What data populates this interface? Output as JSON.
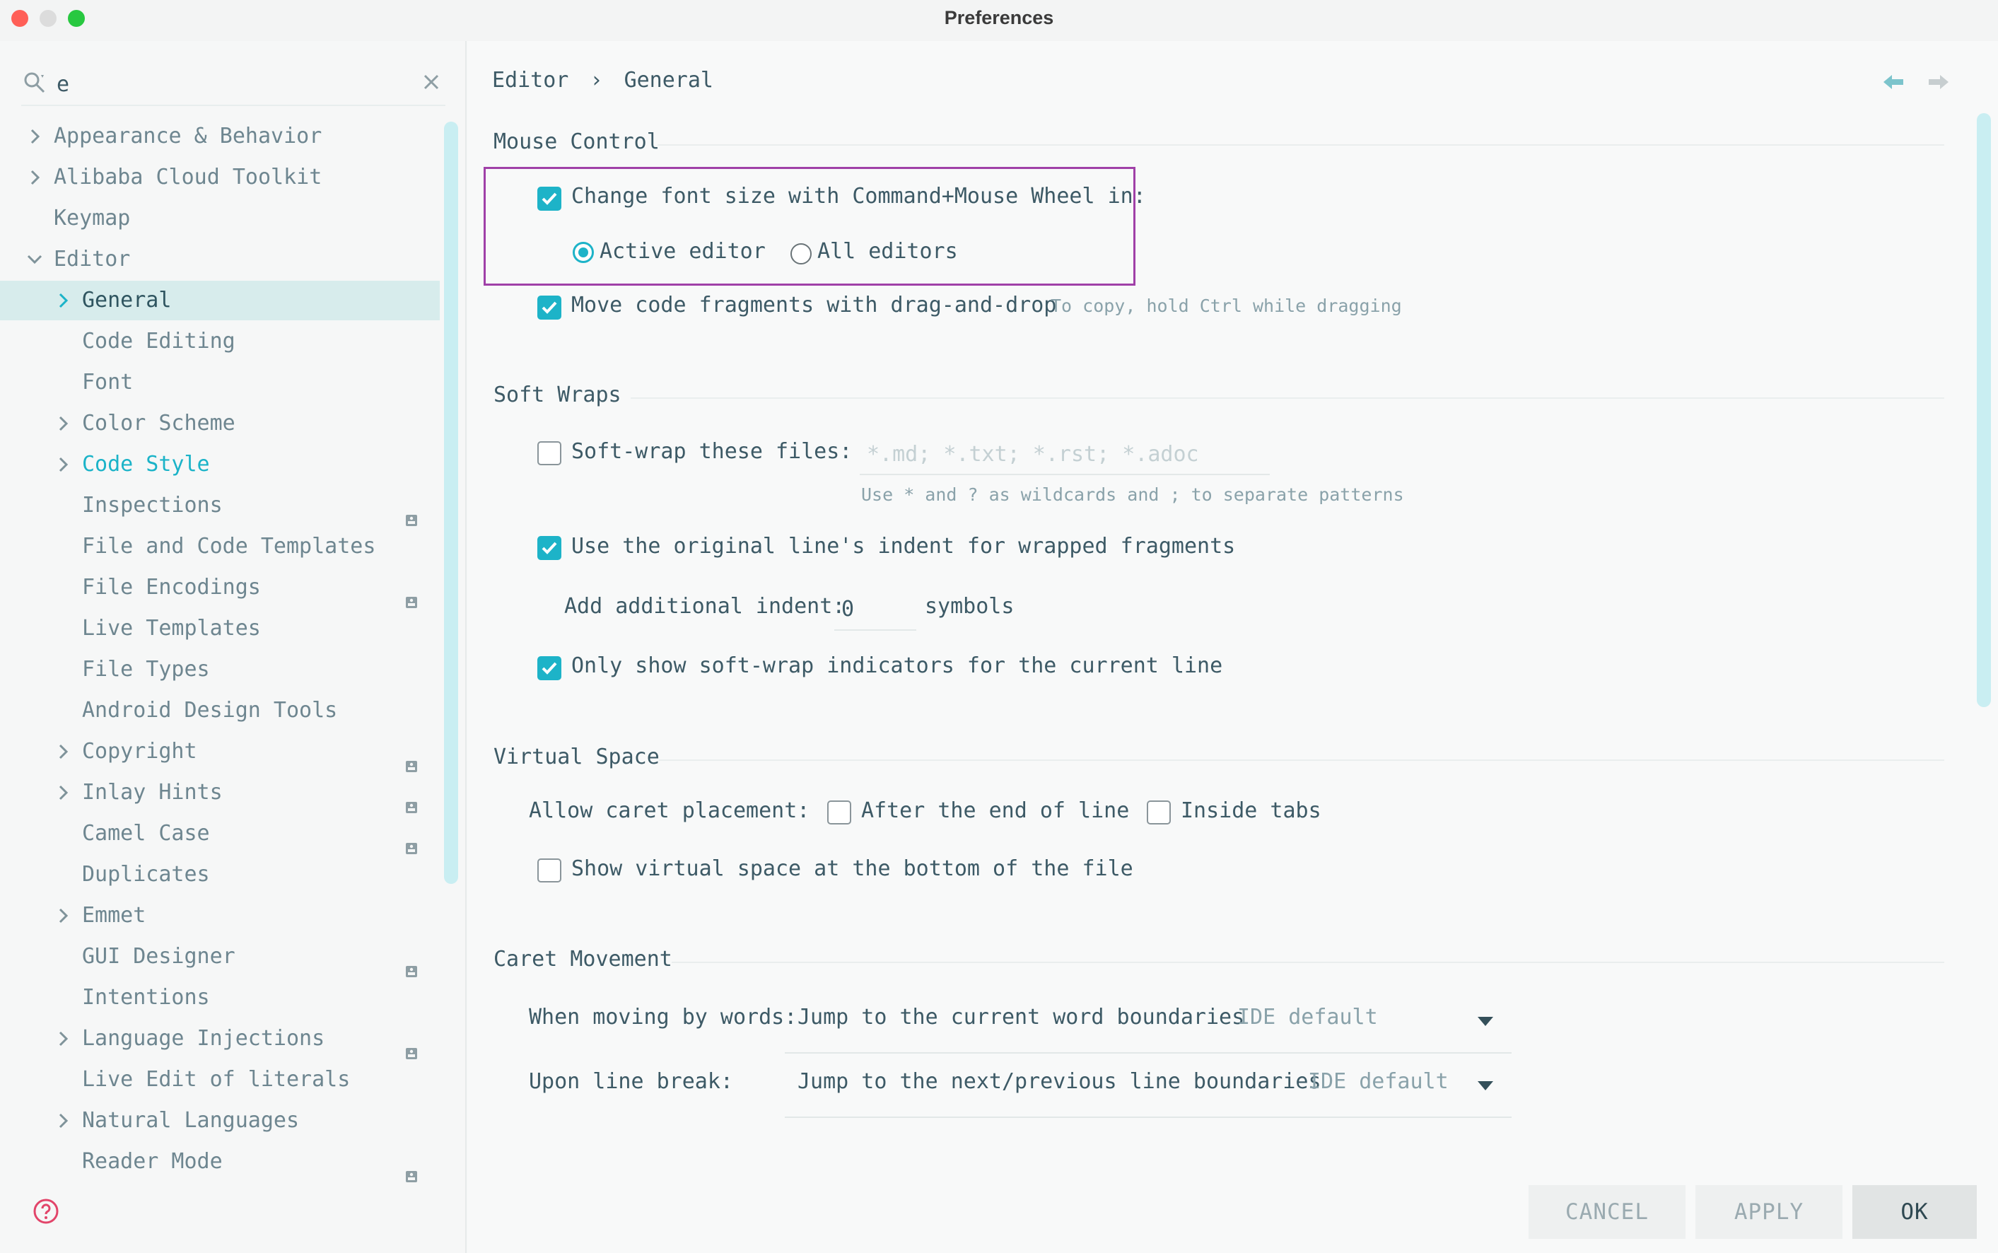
{
  "window": {
    "title": "Preferences",
    "controls": {
      "close_color": "#ff5f57",
      "minimize_color": "#dcdcdc",
      "maximize_color": "#28c840"
    }
  },
  "sidebar": {
    "search": {
      "value": "e",
      "placeholder": ""
    },
    "items": [
      {
        "label": "Appearance & Behavior",
        "level": 0,
        "expandable": true
      },
      {
        "label": "Alibaba Cloud Toolkit",
        "level": 0,
        "expandable": true
      },
      {
        "label": "Keymap",
        "level": 0,
        "expandable": false
      },
      {
        "label": "Editor",
        "level": 0,
        "expandable": true,
        "expanded": true
      },
      {
        "label": "General",
        "level": 1,
        "expandable": true,
        "selected": true
      },
      {
        "label": "Code Editing",
        "level": 1,
        "expandable": false
      },
      {
        "label": "Font",
        "level": 1,
        "expandable": false
      },
      {
        "label": "Color Scheme",
        "level": 1,
        "expandable": true
      },
      {
        "label": "Code Style",
        "level": 1,
        "expandable": true,
        "accent": true
      },
      {
        "label": "Inspections",
        "level": 1,
        "expandable": false,
        "badge": true
      },
      {
        "label": "File and Code Templates",
        "level": 1,
        "expandable": false
      },
      {
        "label": "File Encodings",
        "level": 1,
        "expandable": false,
        "badge": true
      },
      {
        "label": "Live Templates",
        "level": 1,
        "expandable": false
      },
      {
        "label": "File Types",
        "level": 1,
        "expandable": false
      },
      {
        "label": "Android Design Tools",
        "level": 1,
        "expandable": false
      },
      {
        "label": "Copyright",
        "level": 1,
        "expandable": true,
        "badge": true
      },
      {
        "label": "Inlay Hints",
        "level": 1,
        "expandable": true,
        "badge": true
      },
      {
        "label": "Camel Case",
        "level": 1,
        "expandable": false,
        "badge": true
      },
      {
        "label": "Duplicates",
        "level": 1,
        "expandable": false
      },
      {
        "label": "Emmet",
        "level": 1,
        "expandable": true
      },
      {
        "label": "GUI Designer",
        "level": 1,
        "expandable": false,
        "badge": true
      },
      {
        "label": "Intentions",
        "level": 1,
        "expandable": false
      },
      {
        "label": "Language Injections",
        "level": 1,
        "expandable": true,
        "badge": true
      },
      {
        "label": "Live Edit of literals",
        "level": 1,
        "expandable": false
      },
      {
        "label": "Natural Languages",
        "level": 1,
        "expandable": true
      },
      {
        "label": "Reader Mode",
        "level": 1,
        "expandable": false,
        "badge": true
      }
    ]
  },
  "breadcrumb": {
    "parent": "Editor",
    "separator": "›",
    "current": "General"
  },
  "mouse_control": {
    "title": "Mouse Control",
    "font_size_wheel": {
      "label": "Change font size with Command+Mouse Wheel in:",
      "checked": true
    },
    "radio_active": {
      "label": "Active editor",
      "selected": true
    },
    "radio_all": {
      "label": "All editors",
      "selected": false
    },
    "drag_drop": {
      "label": "Move code fragments with drag-and-drop",
      "checked": true,
      "hint": "To copy, hold Ctrl while dragging"
    }
  },
  "soft_wraps": {
    "title": "Soft Wraps",
    "wrap_files": {
      "label": "Soft-wrap these files:",
      "checked": false,
      "value": "",
      "placeholder": "*.md; *.txt; *.rst; *.adoc",
      "hint": "Use * and ? as wildcards and ; to separate patterns"
    },
    "original_indent": {
      "label": "Use the original line's indent for wrapped fragments",
      "checked": true
    },
    "additional_indent": {
      "label": "Add additional indent:",
      "value": "0",
      "suffix": "symbols"
    },
    "current_line_only": {
      "label": "Only show soft-wrap indicators for the current line",
      "checked": true
    }
  },
  "virtual_space": {
    "title": "Virtual Space",
    "caret_label": "Allow caret placement:",
    "after_end": {
      "label": "After the end of line",
      "checked": false
    },
    "inside_tabs": {
      "label": "Inside tabs",
      "checked": false
    },
    "bottom": {
      "label": "Show virtual space at the bottom of the file",
      "checked": false
    }
  },
  "caret_movement": {
    "title": "Caret Movement",
    "by_words": {
      "label": "When moving by words:",
      "value": "Jump to the current word boundaries",
      "note": "IDE default"
    },
    "line_break": {
      "label": "Upon line break:",
      "value": "Jump to the next/previous line boundaries",
      "note": "IDE default"
    }
  },
  "buttons": {
    "cancel": "CANCEL",
    "apply": "APPLY",
    "ok": "OK"
  },
  "colors": {
    "accent": "#1db3c8",
    "selection": "#d7ecec",
    "highlight_box": "#a040a8",
    "help": "#e2456a"
  }
}
